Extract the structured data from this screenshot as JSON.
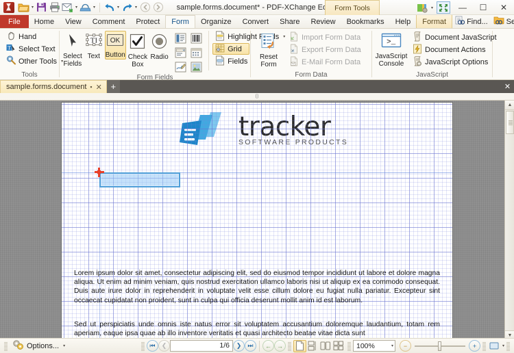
{
  "titlebar": {
    "app_title": "sample.forms.document* - PDF-XChange Editor",
    "context_tab": "Form Tools",
    "quick_access": [
      {
        "name": "open-icon",
        "label": "Open"
      },
      {
        "name": "save-icon",
        "label": "Save"
      },
      {
        "name": "print-icon",
        "label": "Print"
      },
      {
        "name": "email-icon",
        "label": "Email"
      },
      {
        "name": "scan-icon",
        "label": "Scan"
      },
      {
        "name": "undo-icon",
        "label": "Undo"
      },
      {
        "name": "redo-icon",
        "label": "Redo"
      },
      {
        "name": "back-icon",
        "label": "Back"
      },
      {
        "name": "forward-icon",
        "label": "Forward"
      }
    ],
    "customize_label": "Customize Quick Access Toolbar",
    "fullscreen_label": "Full Screen",
    "minimize": "—",
    "maximize": "☐",
    "close": "✕"
  },
  "menubar": {
    "tabs": [
      {
        "label": "File",
        "state": "file"
      },
      {
        "label": "Home",
        "state": "normal"
      },
      {
        "label": "View",
        "state": "normal"
      },
      {
        "label": "Comment",
        "state": "normal"
      },
      {
        "label": "Protect",
        "state": "normal"
      },
      {
        "label": "Form",
        "state": "active"
      },
      {
        "label": "Organize",
        "state": "normal"
      },
      {
        "label": "Convert",
        "state": "normal"
      },
      {
        "label": "Share",
        "state": "normal"
      },
      {
        "label": "Review",
        "state": "normal"
      },
      {
        "label": "Bookmarks",
        "state": "normal"
      },
      {
        "label": "Help",
        "state": "normal"
      },
      {
        "label": "Format",
        "state": "ctxactive"
      }
    ],
    "find_label": "Find...",
    "search_label": "Search...",
    "collapse_caret": "⌃"
  },
  "ribbon": {
    "groups": [
      {
        "name": "tools",
        "label": "Tools",
        "items": [
          {
            "label": "Hand",
            "icon": "hand-icon"
          },
          {
            "label": "Select Text",
            "icon": "select-text-icon"
          },
          {
            "label": "Other Tools",
            "icon": "other-tools-icon",
            "dropdown": true
          }
        ]
      },
      {
        "name": "form-fields",
        "label": "Form Fields",
        "select_fields": "Select\nFields",
        "select_fields_label": "Select Fields",
        "text_label": "Text",
        "button_label": "Button",
        "checkbox_label": "Check\nBox",
        "checkbox_label_flat": "Check Box",
        "radio_label": "Radio",
        "small_icons": [
          {
            "name": "list-box-icon",
            "label": "List Box"
          },
          {
            "name": "barcode-icon",
            "label": "Barcode"
          },
          {
            "name": "dropdown-icon",
            "label": "Drop-down"
          },
          {
            "name": "date-icon",
            "label": "Date"
          },
          {
            "name": "signature-icon",
            "label": "Signature"
          },
          {
            "name": "image-icon",
            "label": "Image"
          }
        ],
        "highlight_fields": "Highlight Fields",
        "grid": "Grid",
        "fields": "Fields"
      },
      {
        "name": "form-data",
        "label": "Form Data",
        "reset_form": "Reset\nForm",
        "reset_form_label": "Reset Form",
        "import_form_data": "Import Form Data",
        "export_form_data": "Export Form Data",
        "email_form_data": "E-Mail Form Data"
      },
      {
        "name": "javascript",
        "label": "JavaScript",
        "console": "JavaScript\nConsole",
        "console_label": "JavaScript Console",
        "document_javascript": "Document JavaScript",
        "document_actions": "Document Actions",
        "javascript_options": "JavaScript Options"
      }
    ],
    "selected_tool": "Button",
    "toggled_on": "Grid"
  },
  "doctabs": {
    "tabs": [
      {
        "label": "sample.forms.document",
        "modified": "▪",
        "close": "✕"
      }
    ],
    "new_tab": "+",
    "close_all": "✕"
  },
  "document": {
    "logo_main": "tracker",
    "logo_sub": "SOFTWARE PRODUCTS",
    "paragraph_1": "Lorem ipsum dolor sit amet, consectetur adipiscing elit, sed do eiusmod tempor incididunt ut labore et dolore magna aliqua. Ut enim ad minim veniam, quis nostrud exercitation ullamco laboris nisi ut aliquip ex ea commodo consequat. Duis aute irure dolor in reprehenderit in voluptate velit esse cillum dolore eu fugiat nulla pariatur. Excepteur sint occaecat cupidatat non proident, sunt in culpa qui officia deserunt mollit anim id est laborum.",
    "paragraph_2": "Sed ut perspiciatis unde omnis iste natus error sit voluptatem accusantium doloremque laudantium, totam rem aperiam, eaque ipsa quae ab illo inventore veritatis et quasi architecto beatae vitae dicta sunt",
    "field_being_drawn": "button-form-field",
    "grid_visible": true
  },
  "statusbar": {
    "options_label": "Options...",
    "first_page": "⏮",
    "prev_page": "❮",
    "page_value": "1/6",
    "next_page": "❯",
    "last_page": "⏭",
    "nav_back": "←",
    "nav_forward": "→",
    "view_single": "single-page-view",
    "view_continuous": "continuous-view",
    "view_two_page": "two-page-view",
    "view_two_continuous": "two-page-continuous-view",
    "zoom_value": "100%",
    "zoom_out": "−",
    "zoom_in": "+",
    "fit_label": "fit-page"
  },
  "colors": {
    "accent_red": "#c0392b",
    "tab_yellow": "#f8e3a8",
    "selection_blue": "#4f9fd8",
    "crosshair_red": "#e8402a",
    "grid_blue": "#5a64c8"
  }
}
